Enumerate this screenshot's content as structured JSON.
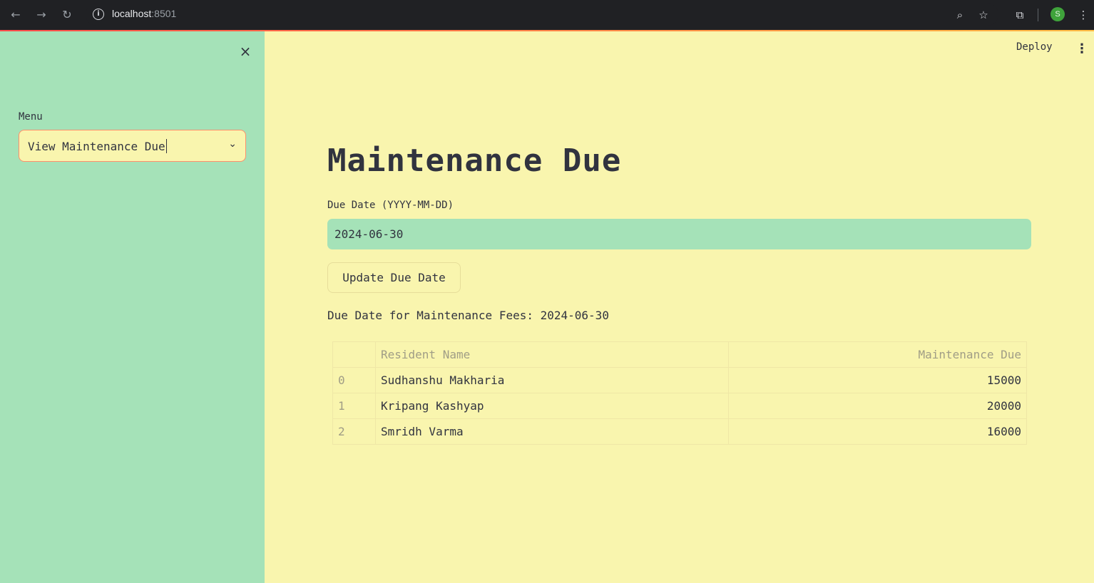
{
  "browser": {
    "url_host": "localhost",
    "url_port": ":8501",
    "profile_initial": "S",
    "icons": [
      "back-icon",
      "forward-icon",
      "reload-icon",
      "info-icon",
      "zoom-icon",
      "star-icon",
      "extensions-icon",
      "more-icon"
    ]
  },
  "sidebar": {
    "menu_label": "Menu",
    "menu_selected": "View Maintenance Due",
    "close_icon": "×",
    "chevron_icon": "⌄"
  },
  "header": {
    "deploy_label": "Deploy",
    "more_icon": "⋮"
  },
  "main": {
    "title": "Maintenance Due",
    "due_date_label": "Due Date (YYYY-MM-DD)",
    "due_date_value": "2024-06-30",
    "update_button_label": "Update Due Date",
    "due_text": "Due Date for Maintenance Fees: 2024-06-30"
  },
  "table": {
    "columns": [
      "",
      "Resident Name",
      "Maintenance Due"
    ],
    "rows": [
      {
        "index": "0",
        "name": "Sudhanshu Makharia",
        "due": "15000"
      },
      {
        "index": "1",
        "name": "Kripang Kashyap",
        "due": "20000"
      },
      {
        "index": "2",
        "name": "Smridh Varma",
        "due": "16000"
      }
    ]
  },
  "colors": {
    "sidebar_bg": "#a5e2b8",
    "main_bg": "#f9f5ae",
    "select_border": "#ff8f6b",
    "text": "#31333f"
  }
}
